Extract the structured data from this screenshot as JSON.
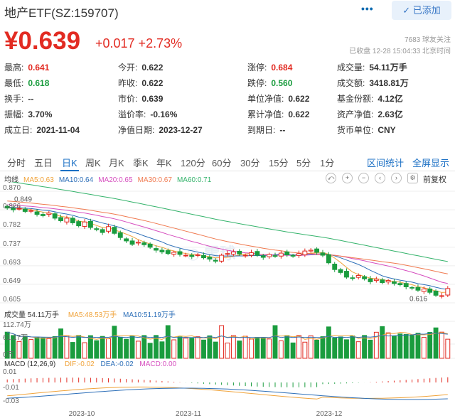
{
  "header": {
    "title": "地产ETF(SZ:159707)",
    "more_label": "•••",
    "added_label": "已添加",
    "price": "¥0.639",
    "change": "+0.017 +2.73%",
    "followers": "7683 球友关注",
    "status": "已收盘 12-28 15:04:33 北京时间"
  },
  "stats": [
    {
      "label": "最高:",
      "value": "0.641",
      "color": "red"
    },
    {
      "label": "今开:",
      "value": "0.622",
      "color": ""
    },
    {
      "label": "涨停:",
      "value": "0.684",
      "color": "red"
    },
    {
      "label": "成交量:",
      "value": "54.11万手",
      "color": ""
    },
    {
      "label": "最低:",
      "value": "0.618",
      "color": "green"
    },
    {
      "label": "昨收:",
      "value": "0.622",
      "color": ""
    },
    {
      "label": "跌停:",
      "value": "0.560",
      "color": "green"
    },
    {
      "label": "成交额:",
      "value": "3418.81万",
      "color": ""
    },
    {
      "label": "换手:",
      "value": "--",
      "color": ""
    },
    {
      "label": "市价:",
      "value": "0.639",
      "color": ""
    },
    {
      "label": "单位净值:",
      "value": "0.622",
      "color": ""
    },
    {
      "label": "基金份额:",
      "value": "4.12亿",
      "color": ""
    },
    {
      "label": "振幅:",
      "value": "3.70%",
      "color": ""
    },
    {
      "label": "溢价率:",
      "value": "-0.16%",
      "color": ""
    },
    {
      "label": "累计净值:",
      "value": "0.622",
      "color": ""
    },
    {
      "label": "资产净值:",
      "value": "2.63亿",
      "color": ""
    },
    {
      "label": "成立日:",
      "value": "2021-11-04",
      "color": ""
    },
    {
      "label": "净值日期:",
      "value": "2023-12-27",
      "color": ""
    },
    {
      "label": "到期日:",
      "value": "--",
      "color": ""
    },
    {
      "label": "货币单位:",
      "value": "CNY",
      "color": ""
    }
  ],
  "tabs": [
    "分时",
    "五日",
    "日K",
    "周K",
    "月K",
    "季K",
    "年K",
    "120分",
    "60分",
    "30分",
    "15分",
    "5分",
    "1分"
  ],
  "active_tab": "日K",
  "tab_links": [
    "区间统计",
    "全屏显示"
  ],
  "kline_legend": {
    "label": "均线",
    "ma": [
      {
        "text": "MA5:0.63",
        "color": "#f0a33a"
      },
      {
        "text": "MA10:0.64",
        "color": "#2d6fb8"
      },
      {
        "text": "MA20:0.65",
        "color": "#d64fbf"
      },
      {
        "text": "MA30:0.67",
        "color": "#f07a50"
      },
      {
        "text": "MA60:0.71",
        "color": "#34b36b"
      }
    ],
    "adjust_label": "前复权"
  },
  "volume_legend": {
    "label": "成交量 54.11万手",
    "ma5": "MA5:48.53万手",
    "ma10": "MA10:51.19万手"
  },
  "macd_legend": {
    "label": "MACD (12,26,9)",
    "dif": "DIF:-0.02",
    "dea": "DEA:-0.02",
    "macd": "MACD:0.00"
  },
  "chart_data": {
    "type": "candlestick",
    "price_axis_ticks": [
      "0.870",
      "0.826",
      "0.782",
      "0.737",
      "0.693",
      "0.649",
      "0.605"
    ],
    "price_ylim": [
      0.605,
      0.87
    ],
    "high_label": "0.849",
    "low_label": "0.616",
    "volume_axis_ticks": [
      "112.74万",
      "61.17万",
      "0万"
    ],
    "macd_axis_ticks": [
      "0.01",
      "-0.01",
      "-0.03"
    ],
    "x_labels": [
      "2023-10",
      "2023-11",
      "2023-12"
    ],
    "closes": [
      0.83,
      0.826,
      0.829,
      0.822,
      0.824,
      0.815,
      0.812,
      0.818,
      0.806,
      0.8,
      0.806,
      0.795,
      0.788,
      0.797,
      0.784,
      0.779,
      0.772,
      0.786,
      0.77,
      0.76,
      0.752,
      0.744,
      0.749,
      0.743,
      0.737,
      0.73,
      0.726,
      0.722,
      0.725,
      0.72,
      0.718,
      0.715,
      0.719,
      0.712,
      0.709,
      0.704,
      0.718,
      0.722,
      0.726,
      0.721,
      0.718,
      0.724,
      0.718,
      0.713,
      0.72,
      0.716,
      0.723,
      0.719,
      0.716,
      0.722,
      0.728,
      0.73,
      0.725,
      0.718,
      0.7,
      0.684,
      0.677,
      0.666,
      0.664,
      0.67,
      0.662,
      0.655,
      0.661,
      0.653,
      0.658,
      0.651,
      0.648,
      0.643,
      0.64,
      0.635,
      0.638,
      0.63,
      0.623,
      0.622,
      0.639
    ]
  }
}
